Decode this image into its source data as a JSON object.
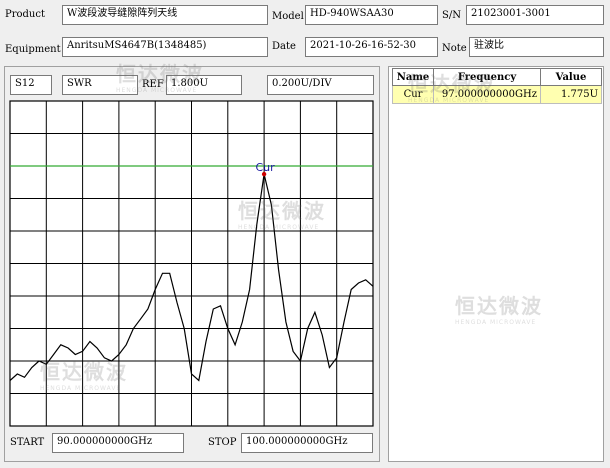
{
  "header": {
    "product_label": "Product",
    "product_value": "W波段波导缝隙阵列天线",
    "model_label": "Model",
    "model_value": "HD-940WSAA30",
    "sn_label": "S/N",
    "sn_value": "21023001-3001",
    "equipment_label": "Equipment",
    "equipment_value": "AnritsuMS4647B(1348485)",
    "date_label": "Date",
    "date_value": "2021-10-26-16-52-30",
    "note_label": "Note",
    "note_value": "驻波比"
  },
  "plot_header": {
    "param": "S12",
    "format": "SWR",
    "ref_label": "REF",
    "ref_value": "1.800U",
    "scale": "0.200U/DIV"
  },
  "footer": {
    "start_label": "START",
    "start_value": "90.000000000GHz",
    "stop_label": "STOP",
    "stop_value": "100.000000000GHz"
  },
  "marker_table": {
    "headers": [
      "Name",
      "Frequency",
      "Value"
    ],
    "rows": [
      {
        "name": "Cur",
        "frequency": "97.000000000GHz",
        "value": "1.775U"
      }
    ]
  },
  "watermark": {
    "cn": "恒达微波",
    "en": "HENGDA MICROWAVE"
  },
  "chart_data": {
    "type": "line",
    "x_unit": "GHz",
    "y_unit": "U",
    "xlim": [
      90,
      100
    ],
    "ylim": [
      1.0,
      2.0
    ],
    "reference_level": 1.8,
    "scale_per_div": 0.2,
    "x_divisions": 10,
    "y_divisions": 10,
    "grid": true,
    "reference_line_color": "#33aa33",
    "trace_color": "#000000",
    "marker": {
      "label": "Cur",
      "x": 97.0,
      "y": 1.775,
      "color": "#cc0000",
      "label_color": "#1a1aa0"
    },
    "series": [
      {
        "x": [
          90.0,
          90.2,
          90.4,
          90.6,
          90.8,
          91.0,
          91.2,
          91.4,
          91.6,
          91.8,
          92.0,
          92.2,
          92.4,
          92.6,
          92.8,
          93.0,
          93.2,
          93.4,
          93.6,
          93.8,
          94.0,
          94.2,
          94.4,
          94.6,
          94.8,
          95.0,
          95.2,
          95.4,
          95.6,
          95.8,
          96.0,
          96.2,
          96.4,
          96.6,
          96.8,
          97.0,
          97.2,
          97.4,
          97.6,
          97.8,
          98.0,
          98.2,
          98.4,
          98.6,
          98.8,
          99.0,
          99.2,
          99.4,
          99.6,
          99.8,
          100.0
        ],
        "y": [
          1.14,
          1.16,
          1.15,
          1.18,
          1.2,
          1.19,
          1.22,
          1.25,
          1.24,
          1.22,
          1.23,
          1.26,
          1.24,
          1.21,
          1.2,
          1.22,
          1.25,
          1.3,
          1.33,
          1.36,
          1.42,
          1.47,
          1.47,
          1.38,
          1.3,
          1.16,
          1.14,
          1.26,
          1.36,
          1.37,
          1.3,
          1.25,
          1.32,
          1.42,
          1.62,
          1.775,
          1.68,
          1.48,
          1.32,
          1.23,
          1.2,
          1.3,
          1.35,
          1.28,
          1.18,
          1.21,
          1.32,
          1.42,
          1.44,
          1.45,
          1.43
        ]
      }
    ]
  }
}
